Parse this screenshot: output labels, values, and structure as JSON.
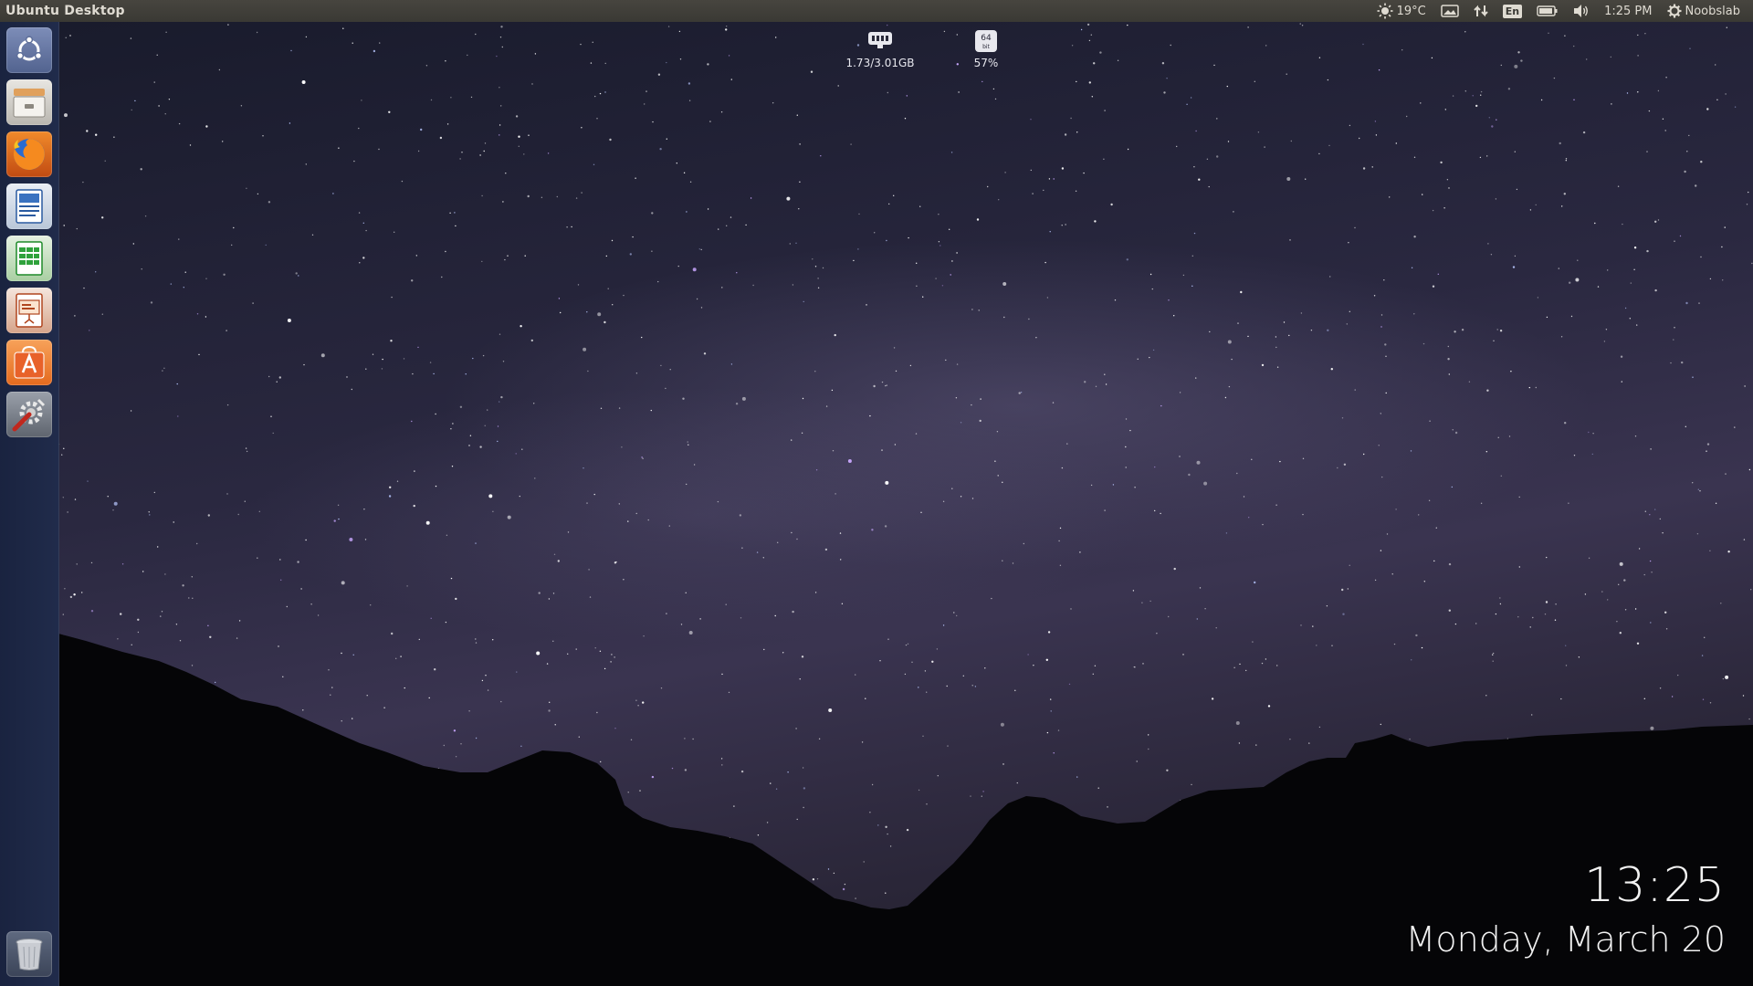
{
  "top_panel": {
    "title": "Ubuntu Desktop",
    "weather_temp": "19°C",
    "keyboard_layout": "En",
    "time": "1:25 PM",
    "session_user": "Noobslab",
    "icons": [
      "sun-icon",
      "display-icon",
      "network-arrows-icon",
      "keyboard-layout-icon",
      "battery-icon",
      "volume-icon",
      "gear-icon"
    ]
  },
  "launcher": {
    "items": [
      {
        "name": "Dash Home",
        "icon": "ubuntu-logo-icon"
      },
      {
        "name": "Files",
        "icon": "files-drawer-icon"
      },
      {
        "name": "Firefox Web Browser",
        "icon": "firefox-icon"
      },
      {
        "name": "LibreOffice Writer",
        "icon": "writer-icon"
      },
      {
        "name": "LibreOffice Calc",
        "icon": "calc-icon"
      },
      {
        "name": "LibreOffice Impress",
        "icon": "impress-icon"
      },
      {
        "name": "Ubuntu Software",
        "icon": "software-center-icon"
      },
      {
        "name": "System Settings",
        "icon": "settings-tools-icon"
      },
      {
        "name": "Trash",
        "icon": "trash-icon"
      }
    ]
  },
  "widgets": {
    "memory": {
      "value": "1.73/3.01GB",
      "icon": "memory-chip-icon"
    },
    "cpu": {
      "value": "57%",
      "icon": "cpu-64bit-icon",
      "badge_top": "64",
      "badge_bottom": "bit"
    }
  },
  "desktop_clock": {
    "time": "13:25",
    "date": "Monday, March 20"
  },
  "colors": {
    "panel_bg": "#3a3934",
    "panel_text": "#dfdbd2",
    "launcher_bg": "#1a2442",
    "sky_dark": "#191b2c",
    "mountain": "#050507"
  }
}
